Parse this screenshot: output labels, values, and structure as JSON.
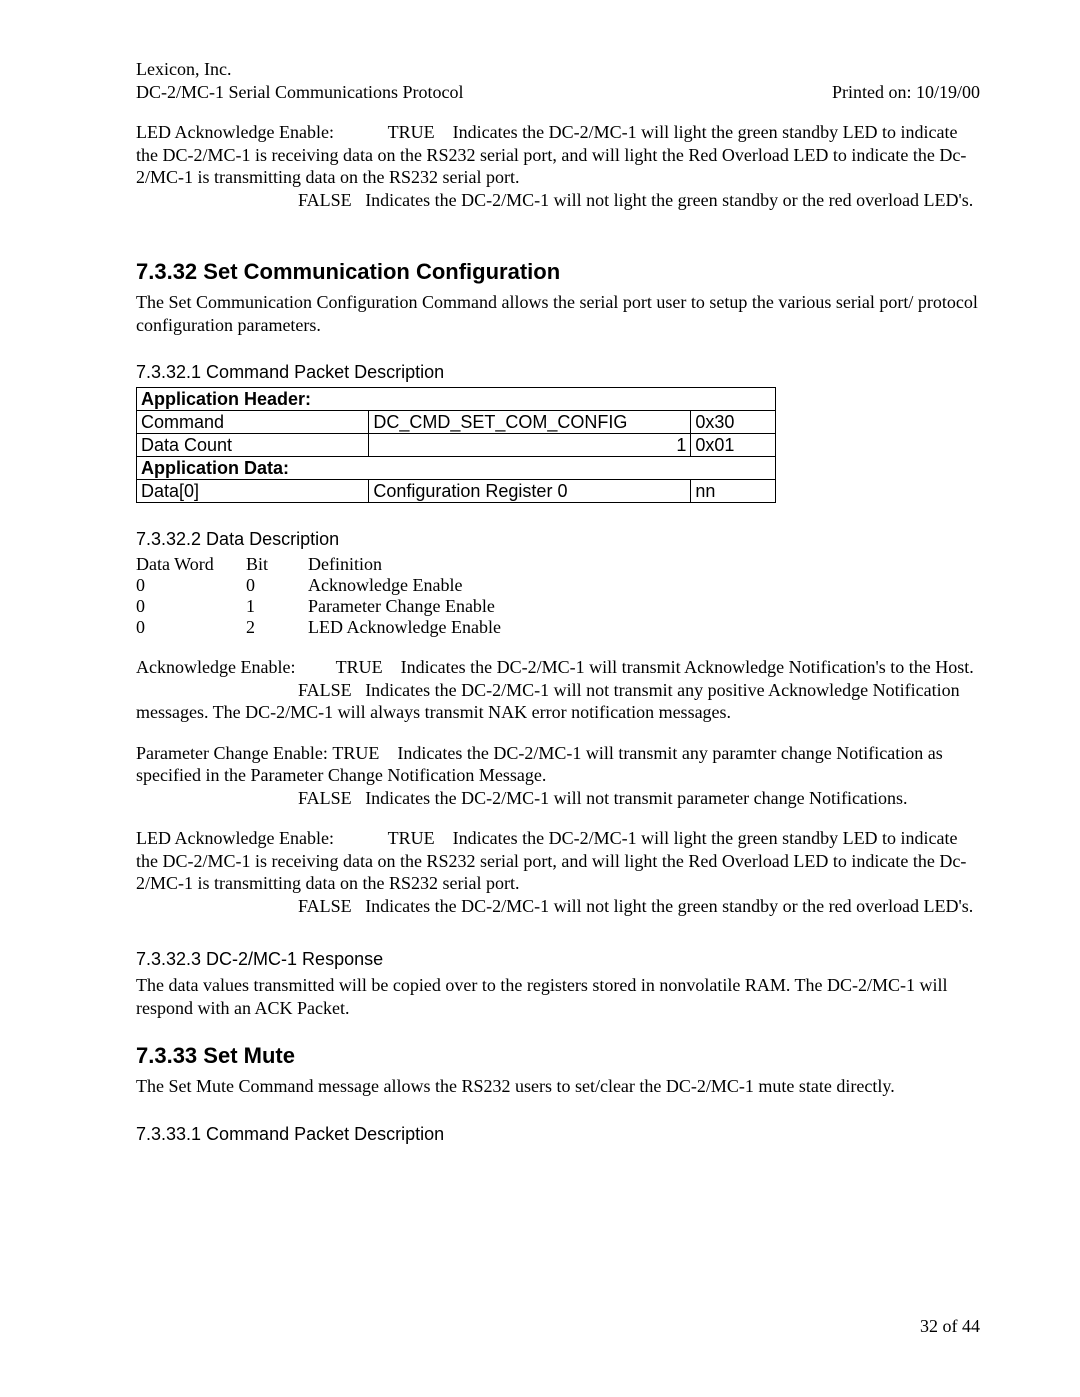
{
  "header": {
    "company": "Lexicon, Inc.",
    "doc": "DC-2/MC-1 Serial Communications Protocol",
    "printed": "Printed on: 10/19/00"
  },
  "top_block": {
    "led_ack_label": "LED Acknowledge Enable:",
    "led_ack_true_prefix": "TRUE",
    "led_ack_true": "Indicates the DC-2/MC-1 will light the green standby LED to indicate the DC-2/MC-1 is receiving data on the RS232 serial port, and will light the Red Overload LED to indicate the Dc-2/MC-1 is transmitting data on the RS232 serial port.",
    "led_ack_false_prefix": "FALSE",
    "led_ack_false": "Indicates the DC-2/MC-1 will not light the green standby or the red overload LED's."
  },
  "sec732": {
    "title": "7.3.32  Set Communication Configuration",
    "intro": " The Set Communication Configuration Command allows the serial port user to setup the various serial port/ protocol configuration parameters.",
    "h_cmd_pkt": "7.3.32.1  Command Packet Description",
    "table": {
      "app_header": "Application Header:",
      "cmd_label": "Command",
      "cmd_name": "DC_CMD_SET_COM_CONFIG",
      "cmd_hex": "0x30",
      "dc_label": "Data Count",
      "dc_num": "1",
      "dc_hex": "0x01",
      "app_data": "Application Data:",
      "d0_label": "Data[0]",
      "d0_name": "Configuration Register 0",
      "d0_hex": "nn"
    },
    "h_data_desc": "7.3.32.2  Data Description",
    "defs": {
      "hdr": {
        "dw": "Data Word",
        "bit": "Bit",
        "def": "Definition"
      },
      "rows": [
        {
          "dw": "0",
          "bit": "0",
          "def": "Acknowledge Enable"
        },
        {
          "dw": "0",
          "bit": "1",
          "def": "Parameter Change Enable"
        },
        {
          "dw": "0",
          "bit": "2",
          "def": "LED Acknowledge Enable"
        }
      ]
    },
    "ack_label": "Acknowledge Enable:",
    "ack_true_prefix": "TRUE",
    "ack_true": "Indicates the DC-2/MC-1 will transmit Acknowledge Notification's to the Host.",
    "ack_false_prefix": "FALSE",
    "ack_false": "Indicates the DC-2/MC-1 will not transmit any positive Acknowledge Notification messages.  The DC-2/MC-1 will always transmit NAK error notification messages.",
    "pc_label": "Parameter Change Enable:",
    "pc_true_prefix": "TRUE",
    "pc_true": "Indicates the DC-2/MC-1 will transmit any paramter change Notification as specified in the Parameter Change Notification Message.",
    "pc_false_prefix": "FALSE",
    "pc_false": "Indicates the DC-2/MC-1 will not transmit parameter change Notifications.",
    "led_label": "LED Acknowledge Enable:",
    "led_true_prefix": "TRUE",
    "led_true": "Indicates the DC-2/MC-1 will light the green standby LED to indicate the DC-2/MC-1 is receiving data on the RS232 serial port, and will light the Red Overload LED to indicate the Dc-2/MC-1 is transmitting data on the RS232 serial port.",
    "led_false_prefix": "FALSE",
    "led_false": "Indicates the DC-2/MC-1 will not light the green standby or the red overload LED's.",
    "h_resp": "7.3.32.3  DC-2/MC-1 Response",
    "resp_body": "The data  values transmitted will be copied over to the registers stored in nonvolatile RAM.  The DC-2/MC-1 will respond with an ACK Packet."
  },
  "sec733": {
    "title": "7.3.33  Set Mute",
    "intro": "The Set Mute Command message allows the RS232 users to set/clear the DC-2/MC-1 mute state directly.",
    "h_cmd_pkt": "7.3.33.1  Command Packet Description"
  },
  "footer": "32 of 44"
}
